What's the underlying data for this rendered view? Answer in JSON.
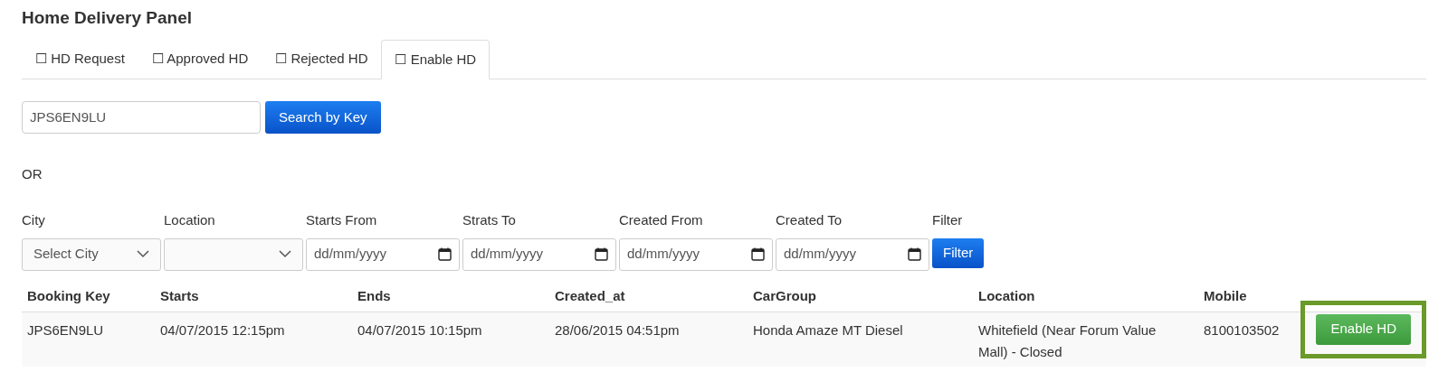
{
  "title": "Home Delivery Panel",
  "tabs": [
    {
      "label": "☐ HD Request",
      "selected": false
    },
    {
      "label": "☐ Approved HD",
      "selected": false
    },
    {
      "label": "☐ Rejected HD",
      "selected": false
    },
    {
      "label": "☐ Enable HD",
      "selected": true
    }
  ],
  "search": {
    "value": "JPS6EN9LU",
    "button": "Search by Key"
  },
  "separator": "OR",
  "filters": [
    {
      "label": "City",
      "kind": "select",
      "value": "Select City"
    },
    {
      "label": "Location",
      "kind": "select"
    },
    {
      "label": "Starts From",
      "kind": "date",
      "placeholder": "dd/mm/yyyy"
    },
    {
      "label": "Strats To",
      "kind": "date",
      "placeholder": "dd/mm/yyyy"
    },
    {
      "label": "Created From",
      "kind": "date",
      "placeholder": "dd/mm/yyyy"
    },
    {
      "label": "Created To",
      "kind": "date",
      "placeholder": "dd/mm/yyyy"
    },
    {
      "label": "Filter",
      "kind": "button",
      "value": "Filter"
    }
  ],
  "table": {
    "columns": [
      "Booking Key",
      "Starts",
      "Ends",
      "Created_at",
      "CarGroup",
      "Location",
      "Mobile"
    ],
    "rows": [
      {
        "cells": [
          "JPS6EN9LU",
          "04/07/2015 12:15pm",
          "04/07/2015 10:15pm",
          "28/06/2015 04:51pm",
          "Honda Amaze MT Diesel",
          "Whitefield (Near Forum Value Mall) - Closed",
          "8100103502"
        ],
        "action": "Enable HD",
        "highlighted": true
      }
    ]
  }
}
